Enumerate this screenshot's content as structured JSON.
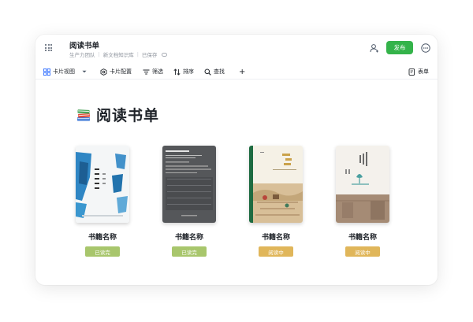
{
  "header": {
    "doc_title": "阅读书单",
    "breadcrumb": [
      "生产力团队",
      "新文档知识库",
      "已保存"
    ],
    "publish_label": "发布"
  },
  "toolbar": {
    "view_label": "卡片视图",
    "card_config_label": "卡片配置",
    "filter_label": "筛选",
    "sort_label": "排序",
    "search_label": "查找",
    "add_label": "+",
    "form_label": "表单"
  },
  "page": {
    "emoji": "books-emoji-icon",
    "title": "阅读书单"
  },
  "books": [
    {
      "name": "书籍名称",
      "status": "已读完",
      "status_color": "#a8c66c"
    },
    {
      "name": "书籍名称",
      "status": "已读完",
      "status_color": "#a8c66c"
    },
    {
      "name": "书籍名称",
      "status": "阅读中",
      "status_color": "#e0b65a"
    },
    {
      "name": "书籍名称",
      "status": "阅读中",
      "status_color": "#e0b65a"
    }
  ],
  "colors": {
    "accent_green": "#34b34a",
    "finished": "#a8c66c",
    "reading": "#e0b65a"
  }
}
